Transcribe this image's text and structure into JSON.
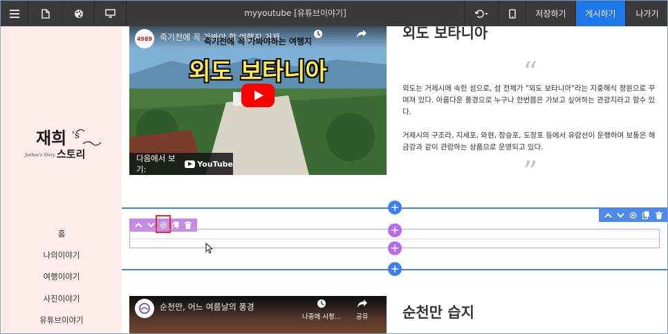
{
  "topbar": {
    "title": "myyoutube [유튜브이야기]",
    "save_label": "저장하기",
    "publish_label": "게시하기",
    "exit_label": "나가기",
    "publish_color": "#1f78e8"
  },
  "sidebar": {
    "logo_text": "재희's 스토리",
    "logo_subtext": "Jaehee's Story",
    "items": [
      {
        "label": "홈"
      },
      {
        "label": "나의이야기"
      },
      {
        "label": "여행이야기"
      },
      {
        "label": "사진이야기"
      },
      {
        "label": "유튜브이야기"
      }
    ]
  },
  "video1": {
    "channel_badge": "4989",
    "title": "죽기전에 꼭 가봐야 할 여행지 거제",
    "overlay_sub": "죽기전에 꼭 가봐야하는 여행지",
    "overlay_title": "외도 보타니아",
    "watch_on_label": "다음에서 보기:",
    "youtube_label": "YouTube"
  },
  "article1": {
    "title": "외도 보타니아",
    "open_quote": "“",
    "close_quote": "”",
    "paragraph1": "외도는 거제시에 속한 섬으로, 섬 전체가 \"외도 보타니아\"라는 지중해식 정원으로 꾸며져 있다. 아름다운 풍경으로 누구나 한번쯤은 가보고 싶어하는 관광지라고 할수 있다.",
    "paragraph2": "거제시의 구조라, 지세포, 와현, 장승포, 도장포 등에서 유람선이 운행하며 보통은 해금강과 같이 관람하는 상품으로 운영되고 있다."
  },
  "video2": {
    "title": "순천만, 어느 여름날의 풍경",
    "watch_later_label": "나중에 시청...",
    "share_label": "공유"
  },
  "article2": {
    "title": "순천만 습지"
  },
  "edit_ui": {
    "plus_symbol": "+",
    "accent_blue": "#3d7ff0",
    "accent_purple": "#b86be8",
    "highlight_color": "#e8262a"
  }
}
